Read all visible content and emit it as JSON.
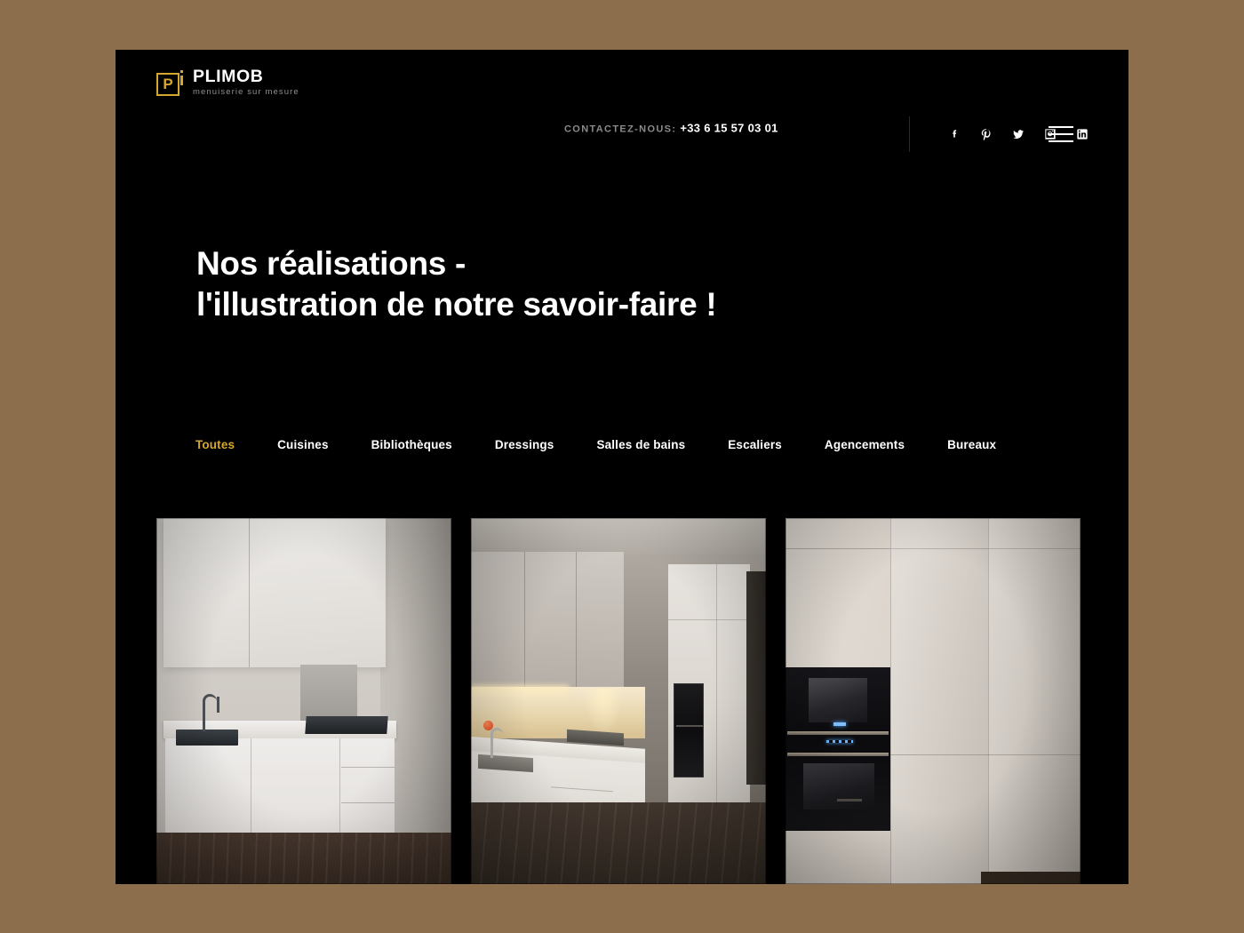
{
  "theme": {
    "page_background": "#8d6e4c",
    "canvas_background": "#000000",
    "accent_gold": "#d6a72f",
    "text_primary": "#ffffff",
    "text_muted": "#8a8a8a"
  },
  "header": {
    "logo": {
      "mark_letter": "P",
      "name": "PLIMOB",
      "tagline": "menuiserie sur mesure"
    },
    "contact": {
      "label": "CONTACTEZ-NOUS:",
      "phone": "+33 6 15 57 03 01"
    },
    "socials": [
      {
        "name": "facebook",
        "icon": "facebook-icon"
      },
      {
        "name": "pinterest",
        "icon": "pinterest-icon"
      },
      {
        "name": "twitter",
        "icon": "twitter-icon"
      },
      {
        "name": "instagram",
        "icon": "instagram-icon"
      },
      {
        "name": "linkedin",
        "icon": "linkedin-icon"
      }
    ],
    "menu_toggle": "menu-icon"
  },
  "hero": {
    "title_line1": "Nos réalisations -",
    "title_line2": "l'illustration de notre savoir-faire !",
    "title": "Nos réalisations -\nl'illustration de notre savoir-faire !"
  },
  "filters": {
    "active": "Toutes",
    "items": [
      {
        "label": "Toutes",
        "active": true
      },
      {
        "label": "Cuisines",
        "active": false
      },
      {
        "label": "Bibliothèques",
        "active": false
      },
      {
        "label": "Dressings",
        "active": false
      },
      {
        "label": "Salles de bains",
        "active": false
      },
      {
        "label": "Escaliers",
        "active": false
      },
      {
        "label": "Agencements",
        "active": false
      },
      {
        "label": "Bureaux",
        "active": false
      }
    ]
  },
  "gallery": {
    "items": [
      {
        "category": "Cuisines",
        "description": "Cuisine blanche linéaire avec meubles hauts, évier noir, mitigeur chromé et plaque de cuisson à induction sur parquet foncé"
      },
      {
        "category": "Cuisines",
        "description": "Cuisine blanche en L avec éclairage LED chaud sous meubles hauts, mitigeur à poignée rouge, plaque induction et colonne four encastré"
      },
      {
        "category": "Cuisines",
        "description": "Façade de rangements toute hauteur laquée blanche avec four et micro-ondes encastrés noirs à afficheurs bleus"
      }
    ]
  }
}
